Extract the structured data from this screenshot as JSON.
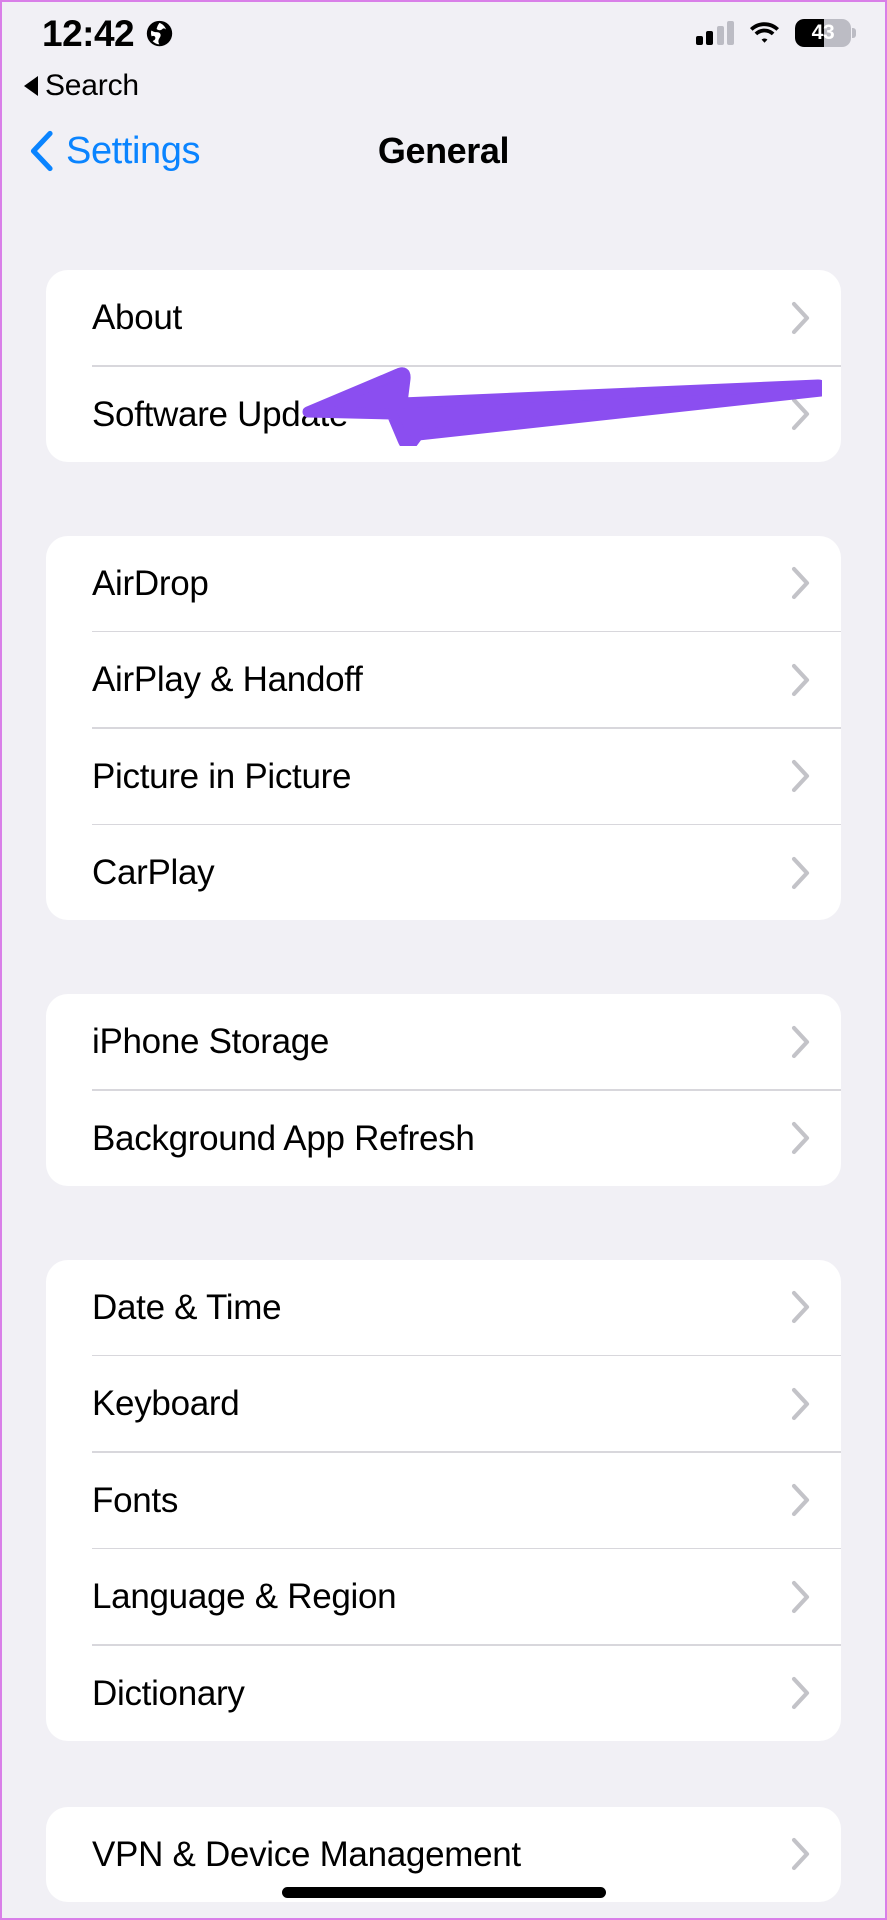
{
  "status_bar": {
    "time": "12:42",
    "globe_icon": "globe-icon",
    "cellular_icon": "cellular-signal-icon",
    "cellular_bars_filled": 2,
    "cellular_bars_total": 4,
    "wifi_icon": "wifi-icon",
    "battery_icon": "battery-icon",
    "battery_level": "43",
    "battery_percent": 43
  },
  "back_to_app": {
    "icon": "back-triangle-icon",
    "label": "Search"
  },
  "nav_bar": {
    "back_icon": "chevron-left-icon",
    "back_label": "Settings",
    "title": "General"
  },
  "annotation": {
    "type": "arrow",
    "direction": "left",
    "color": "#8b4ef0",
    "points_at": "Software Update"
  },
  "colors": {
    "page_background": "#f1f0f5",
    "card_background": "#ffffff",
    "accent_blue": "#0a84ff",
    "separator": "#d8d7dc",
    "chevron_gray": "#c3c3c8",
    "annotation_purple": "#8b4ef0",
    "frame_border": "#d97fe8"
  },
  "groups": [
    {
      "id": "group-device",
      "rows": [
        {
          "label": "About",
          "accessory": "chevron-right-icon"
        },
        {
          "label": "Software Update",
          "accessory": "chevron-right-icon"
        }
      ]
    },
    {
      "id": "group-connectivity",
      "rows": [
        {
          "label": "AirDrop",
          "accessory": "chevron-right-icon"
        },
        {
          "label": "AirPlay & Handoff",
          "accessory": "chevron-right-icon"
        },
        {
          "label": "Picture in Picture",
          "accessory": "chevron-right-icon"
        },
        {
          "label": "CarPlay",
          "accessory": "chevron-right-icon"
        }
      ]
    },
    {
      "id": "group-storage",
      "rows": [
        {
          "label": "iPhone Storage",
          "accessory": "chevron-right-icon"
        },
        {
          "label": "Background App Refresh",
          "accessory": "chevron-right-icon"
        }
      ]
    },
    {
      "id": "group-localization",
      "rows": [
        {
          "label": "Date & Time",
          "accessory": "chevron-right-icon"
        },
        {
          "label": "Keyboard",
          "accessory": "chevron-right-icon"
        },
        {
          "label": "Fonts",
          "accessory": "chevron-right-icon"
        },
        {
          "label": "Language & Region",
          "accessory": "chevron-right-icon"
        },
        {
          "label": "Dictionary",
          "accessory": "chevron-right-icon"
        }
      ]
    },
    {
      "id": "group-management",
      "rows": [
        {
          "label": "VPN & Device Management",
          "accessory": "chevron-right-icon"
        }
      ]
    }
  ]
}
